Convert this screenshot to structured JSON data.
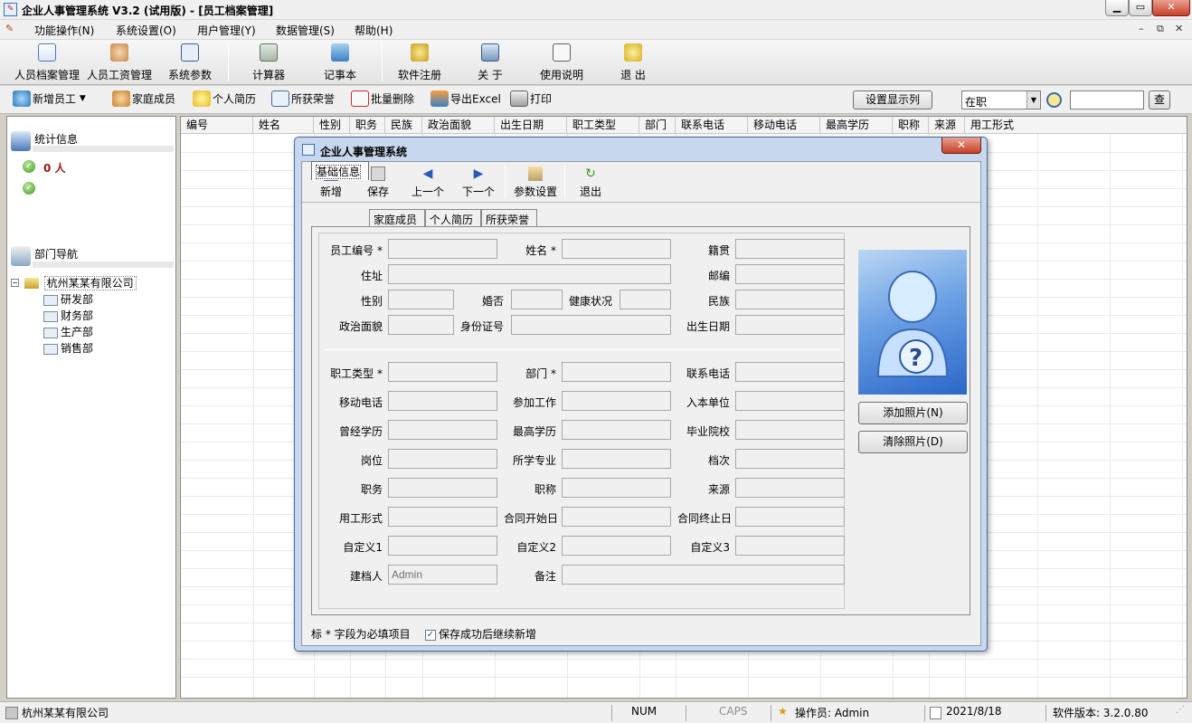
{
  "window": {
    "title": "企业人事管理系统 V3.2 (试用版) - [员工档案管理]"
  },
  "menu": [
    "功能操作(N)",
    "系统设置(O)",
    "用户管理(Y)",
    "数据管理(S)",
    "帮助(H)"
  ],
  "toolbar_main": [
    {
      "label": "人员档案管理",
      "icon": "document-edit-icon"
    },
    {
      "label": "人员工资管理",
      "icon": "user-money-icon"
    },
    {
      "label": "系统参数",
      "icon": "grid-settings-icon"
    },
    {
      "label": "计算器",
      "icon": "calculator-icon"
    },
    {
      "label": "记事本",
      "icon": "notepad-icon"
    },
    {
      "label": "软件注册",
      "icon": "keys-icon"
    },
    {
      "label": "关 于",
      "icon": "info-icon"
    },
    {
      "label": "使用说明",
      "icon": "manual-icon"
    },
    {
      "label": "退 出",
      "icon": "exit-icon"
    }
  ],
  "toolbar_actions": [
    {
      "label": "新增员工",
      "icon": "add-user-icon"
    },
    {
      "label": "家庭成员",
      "icon": "family-icon"
    },
    {
      "label": "个人简历",
      "icon": "star-icon"
    },
    {
      "label": "所获荣誉",
      "icon": "honor-icon"
    },
    {
      "label": "批量删除",
      "icon": "delete-icon"
    },
    {
      "label": "导出Excel",
      "icon": "excel-icon"
    },
    {
      "label": "打印",
      "icon": "printer-icon"
    }
  ],
  "filter": {
    "columns_button": "设置显示列",
    "status_value": "在职",
    "search_value": "",
    "search_button": "查"
  },
  "left_panel": {
    "stats_title": "统计信息",
    "stats_count": "0 人",
    "dept_title": "部门导航",
    "company": "杭州某某有限公司",
    "departments": [
      "研发部",
      "财务部",
      "生产部",
      "销售部"
    ]
  },
  "grid_columns": [
    "编号",
    "姓名",
    "性别",
    "职务",
    "民族",
    "政治面貌",
    "出生日期",
    "职工类型",
    "部门",
    "联系电话",
    "移动电话",
    "最高学历",
    "职称",
    "来源",
    "用工形式"
  ],
  "dialog": {
    "title": "企业人事管理系统",
    "toolbar": [
      {
        "label": "新增",
        "icon": "new-doc-icon"
      },
      {
        "label": "保存",
        "icon": "save-icon"
      },
      {
        "label": "上一个",
        "icon": "arrow-left-icon"
      },
      {
        "label": "下一个",
        "icon": "arrow-right-icon"
      },
      {
        "label": "参数设置",
        "icon": "settings-icon"
      },
      {
        "label": "退出",
        "icon": "exit-icon"
      }
    ],
    "tabs": [
      "基础信息",
      "家庭成员",
      "个人简历",
      "所获荣誉"
    ],
    "fields": {
      "emp_no": "员工编号",
      "name": "姓名",
      "native": "籍贯",
      "address": "住址",
      "postcode": "邮编",
      "gender": "性别",
      "married": "婚否",
      "health": "健康状况",
      "ethnicity": "民族",
      "political": "政治面貌",
      "id_no": "身份证号",
      "birthday": "出生日期",
      "emp_type": "职工类型",
      "dept": "部门",
      "phone": "联系电话",
      "mobile": "移动电话",
      "work_start": "参加工作",
      "join_unit": "入本单位",
      "edu_history": "曾经学历",
      "highest_edu": "最高学历",
      "school": "毕业院校",
      "post": "岗位",
      "major": "所学专业",
      "grade": "档次",
      "duty": "职务",
      "title": "职称",
      "source": "来源",
      "employment": "用工形式",
      "contract_start": "合同开始日",
      "contract_end": "合同终止日",
      "custom1": "自定义1",
      "custom2": "自定义2",
      "custom3": "自定义3",
      "creator": "建档人",
      "remark": "备注"
    },
    "creator_value": "Admin",
    "add_photo": "添加照片(N)",
    "clear_photo": "清除照片(D)",
    "required_note": "标 * 字段为必填项目",
    "continue_label": "保存成功后继续新增",
    "continue_checked": true
  },
  "statusbar": {
    "company": "杭州某某有限公司",
    "num": "NUM",
    "caps": "CAPS",
    "operator": "操作员:  Admin",
    "date": "2021/8/18",
    "version": "软件版本: 3.2.0.80"
  }
}
